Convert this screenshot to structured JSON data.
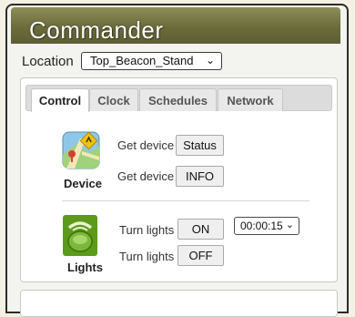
{
  "app": {
    "title": "Commander"
  },
  "location": {
    "label": "Location",
    "selected": "Top_Beacon_Stand"
  },
  "tabs": [
    {
      "label": "Control",
      "active": true
    },
    {
      "label": "Clock",
      "active": false
    },
    {
      "label": "Schedules",
      "active": false
    },
    {
      "label": "Network",
      "active": false
    }
  ],
  "device": {
    "section_label": "Device",
    "icon": "map-icon",
    "rows": [
      {
        "label": "Get device",
        "button": "Status"
      },
      {
        "label": "Get device",
        "button": "INFO"
      }
    ]
  },
  "lights": {
    "section_label": "Lights",
    "icon": "lamp-icon",
    "rows": [
      {
        "label": "Turn lights",
        "button": "ON"
      },
      {
        "label": "Turn lights",
        "button": "OFF"
      }
    ],
    "duration": "00:00:15"
  },
  "colors": {
    "title_bar": "#6b6b3c",
    "lights_icon": "#5c9a1a"
  }
}
